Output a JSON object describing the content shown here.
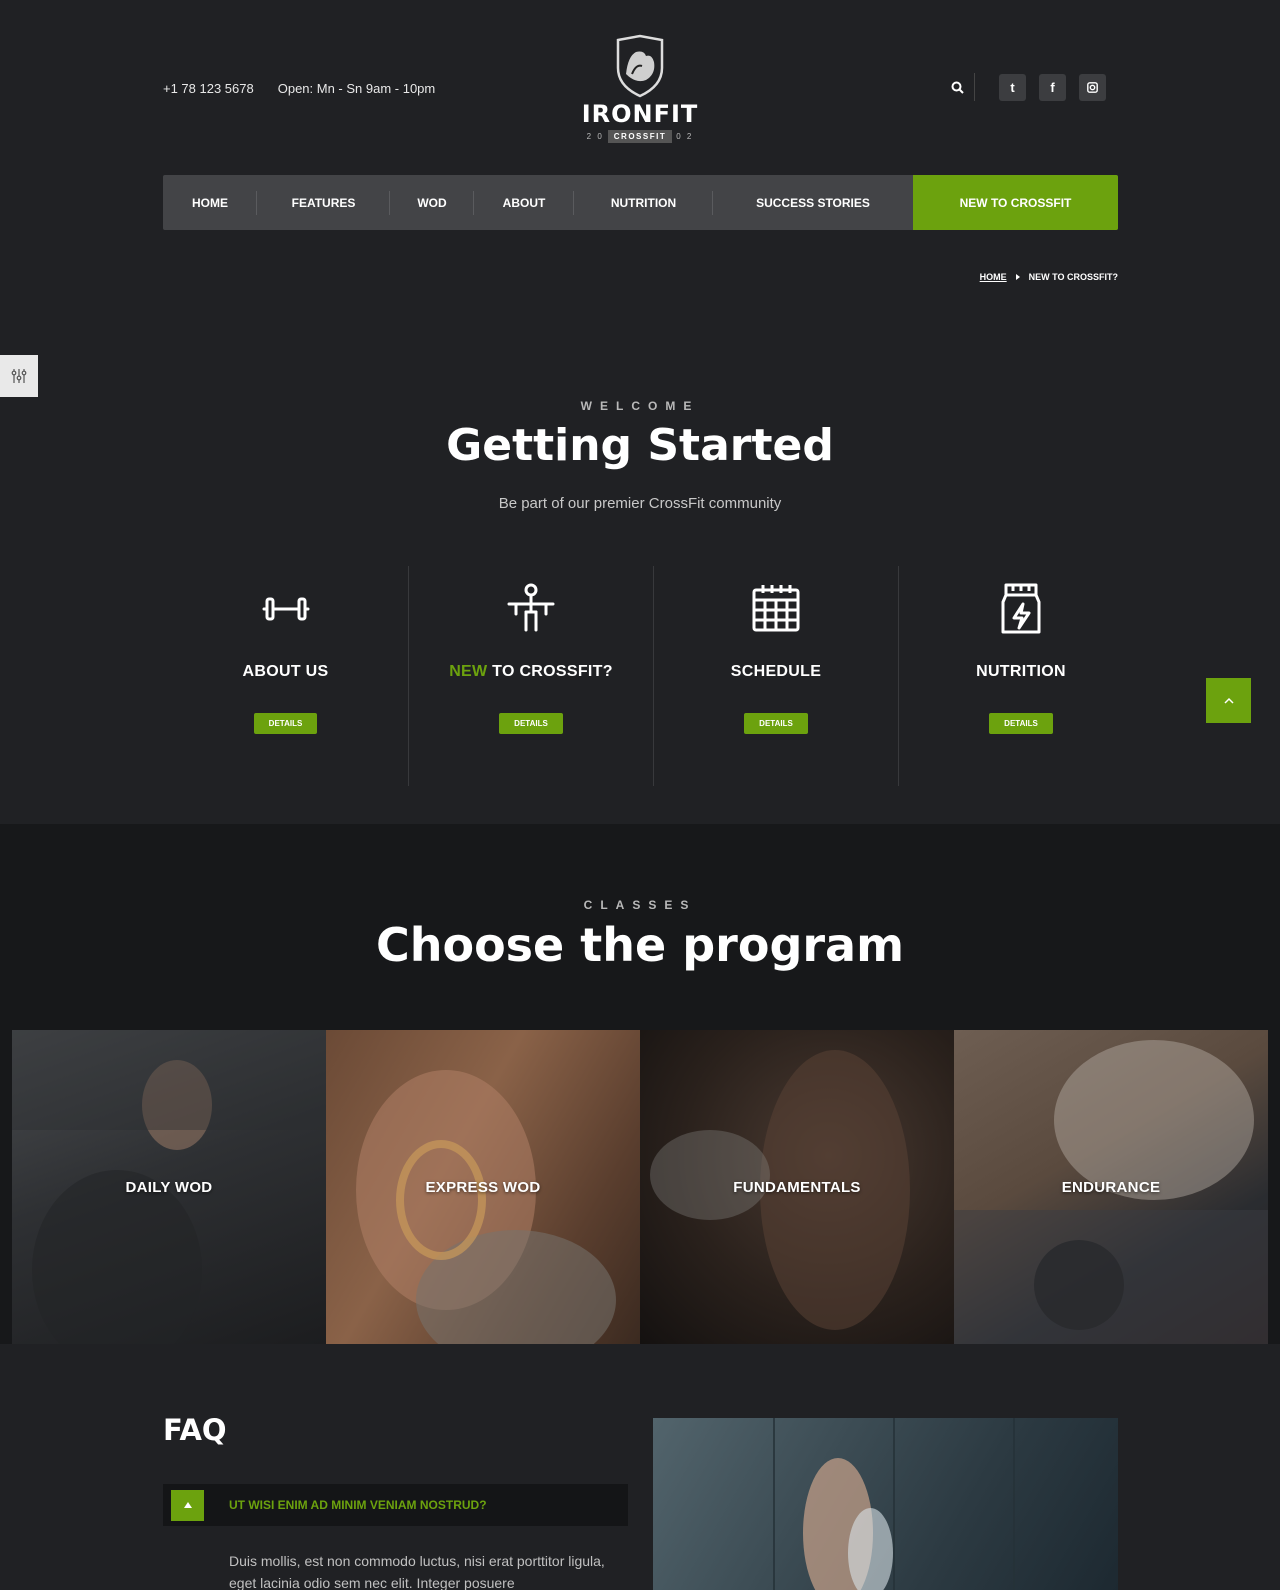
{
  "header": {
    "phone": "+1 78 123 5678",
    "hours": "Open: Mn - Sn 9am - 10pm",
    "logo": {
      "name": "IRONFIT",
      "badge": "CROSSFIT",
      "year_left": "2 0",
      "year_right": "0 2"
    },
    "social": [
      {
        "icon": "twitter-icon",
        "glyph": "t"
      },
      {
        "icon": "facebook-icon",
        "glyph": "f"
      },
      {
        "icon": "instagram-icon",
        "glyph": "◘"
      }
    ]
  },
  "nav": {
    "items": [
      "HOME",
      "FEATURES",
      "WOD",
      "ABOUT",
      "NUTRITION",
      "SUCCESS STORIES"
    ],
    "cta": "NEW TO CROSSFIT"
  },
  "breadcrumb": {
    "home": "HOME",
    "current": "NEW TO CROSSFIT?"
  },
  "welcome": {
    "eyebrow": "WELCOME",
    "title": "Getting Started",
    "subtitle": "Be part of our premier CrossFit community"
  },
  "features": [
    {
      "icon": "dumbbell-icon",
      "title": "ABOUT US",
      "accent": "",
      "button": "DETAILS"
    },
    {
      "icon": "athlete-icon",
      "title": " TO CROSSFIT?",
      "accent": "NEW",
      "button": "DETAILS"
    },
    {
      "icon": "calendar-icon",
      "title": "SCHEDULE",
      "accent": "",
      "button": "DETAILS"
    },
    {
      "icon": "supplement-icon",
      "title": "NUTRITION",
      "accent": "",
      "button": "DETAILS"
    }
  ],
  "classes": {
    "eyebrow": "CLASSES",
    "title": "Choose the program",
    "programs": [
      "DAILY WOD",
      "EXPRESS WOD",
      "FUNDAMENTALS",
      "ENDURANCE"
    ]
  },
  "faq": {
    "title": "FAQ",
    "question": "UT WISI ENIM AD MINIM VENIAM NOSTRUD?",
    "answer": "Duis mollis, est non commodo luctus, nisi erat porttitor ligula, eget lacinia odio sem nec elit. Integer posuere"
  },
  "colors": {
    "accent": "#6ca20e",
    "background": "#202124",
    "nav": "#434447"
  }
}
